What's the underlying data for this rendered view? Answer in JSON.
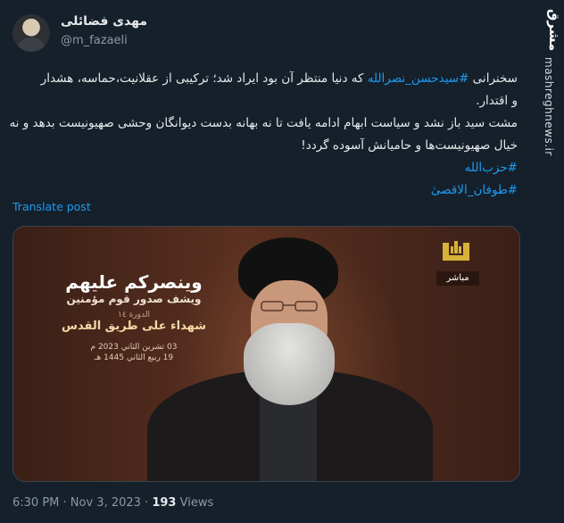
{
  "author": {
    "display_name": "مهدی فضائلی",
    "handle": "@m_fazaeli"
  },
  "tweet": {
    "line1_pre": "سخنرانی ",
    "line1_hashtag": "#سیدحسن_نصرالله",
    "line1_post": " که دنیا منتظر آن بود ایراد شد؛ ترکیبی از عقلانیت،حماسه، هشدار",
    "line2": "و اقتدار.",
    "line3": "مشت سید باز نشد و سیاست ابهام ادامه یافت تا نه بهانه بدست دیوانگان وحشی صهیونیست بدهد و نه",
    "line4": "خیال صهیونیست‌ها و حامیانش آسوده گردد!",
    "hashtag1": "#حزب‌الله",
    "hashtag2": "#طوفان_الاقصیٰ"
  },
  "translate_label": "Translate post",
  "media": {
    "title": "وينصركم عليهم",
    "subtitle": "ويشف صدور قوم مؤمنين",
    "tag": "الدورة ١٤",
    "caption": "شهداء على طريق القدس",
    "date1": "03 تشرين الثاني 2023 م",
    "date2": "19 ربيع الثاني 1445 هـ",
    "live_label": "مباشر"
  },
  "meta": {
    "time": "6:30 PM",
    "separator": " · ",
    "date": "Nov 3, 2023",
    "views_count": "193",
    "views_label": " Views"
  },
  "watermark": {
    "logo": "مشرق",
    "site": "mashreghnews.ir"
  },
  "colors": {
    "background": "#15202b",
    "link": "#1d9bf0",
    "text": "#e7e9ea",
    "muted": "#8b98a5"
  },
  "icons": {
    "channel_logo": "al-manar-logo"
  }
}
